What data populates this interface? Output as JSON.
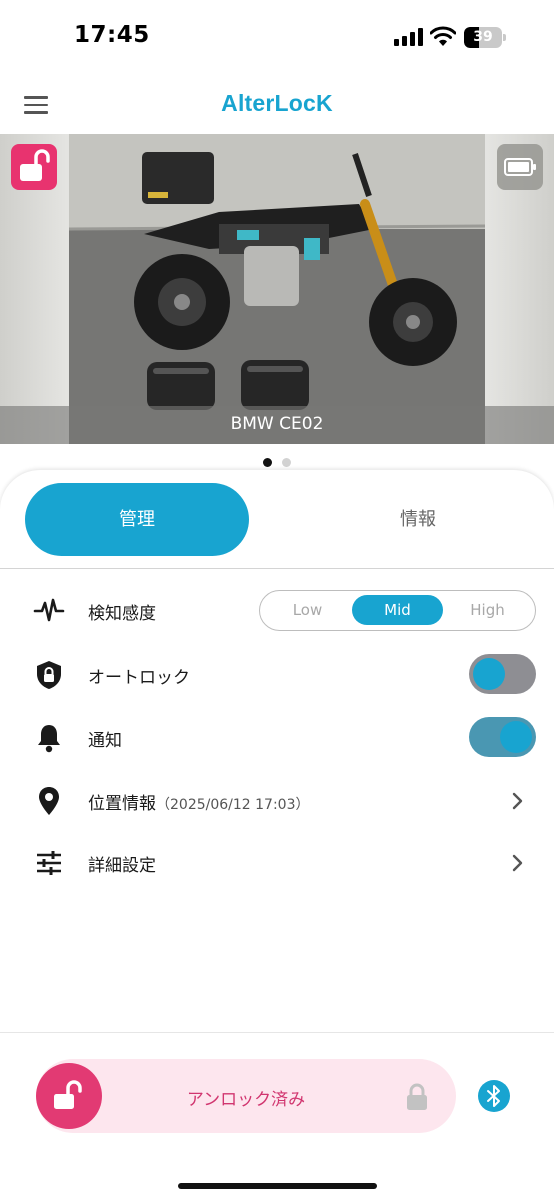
{
  "status_bar": {
    "time": "17:45",
    "battery_level": "39",
    "battery_fraction": 0.39
  },
  "header": {
    "brand": "AlterLocK",
    "menu_icon": "hamburger-menu-icon"
  },
  "vehicle": {
    "name": "BMW CE02",
    "lock_icon": "unlocked-padlock-icon",
    "battery_icon": "battery-full-icon",
    "active_page": 1,
    "page_count": 2
  },
  "tabs": [
    {
      "label": "管理",
      "active": true
    },
    {
      "label": "情報",
      "active": false
    }
  ],
  "settings": {
    "sensitivity": {
      "icon": "activity-pulse-icon",
      "label": "検知感度",
      "options": [
        "Low",
        "Mid",
        "High"
      ],
      "selected": "Mid"
    },
    "auto_lock": {
      "icon": "shield-lock-icon",
      "label": "オートロック",
      "enabled": false
    },
    "notification": {
      "icon": "bell-icon",
      "label": "通知",
      "enabled": true
    },
    "location": {
      "icon": "map-pin-icon",
      "label": "位置情報",
      "timestamp": "（2025/06/12 17:03）"
    },
    "advanced": {
      "icon": "sliders-icon",
      "label": "詳細設定"
    }
  },
  "bottom": {
    "status_label": "アンロック済み",
    "unlock_icon": "unlocked-padlock-icon",
    "lock_hint_icon": "padlock-icon",
    "bluetooth_icon": "bluetooth-icon"
  },
  "colors": {
    "accent": "#18a4d0",
    "unlock_pink": "#e23a73",
    "unlock_pill_bg": "#fde6ee",
    "toggle_off_track": "#8e8e93",
    "toggle_on_track": "#4a97b2"
  }
}
